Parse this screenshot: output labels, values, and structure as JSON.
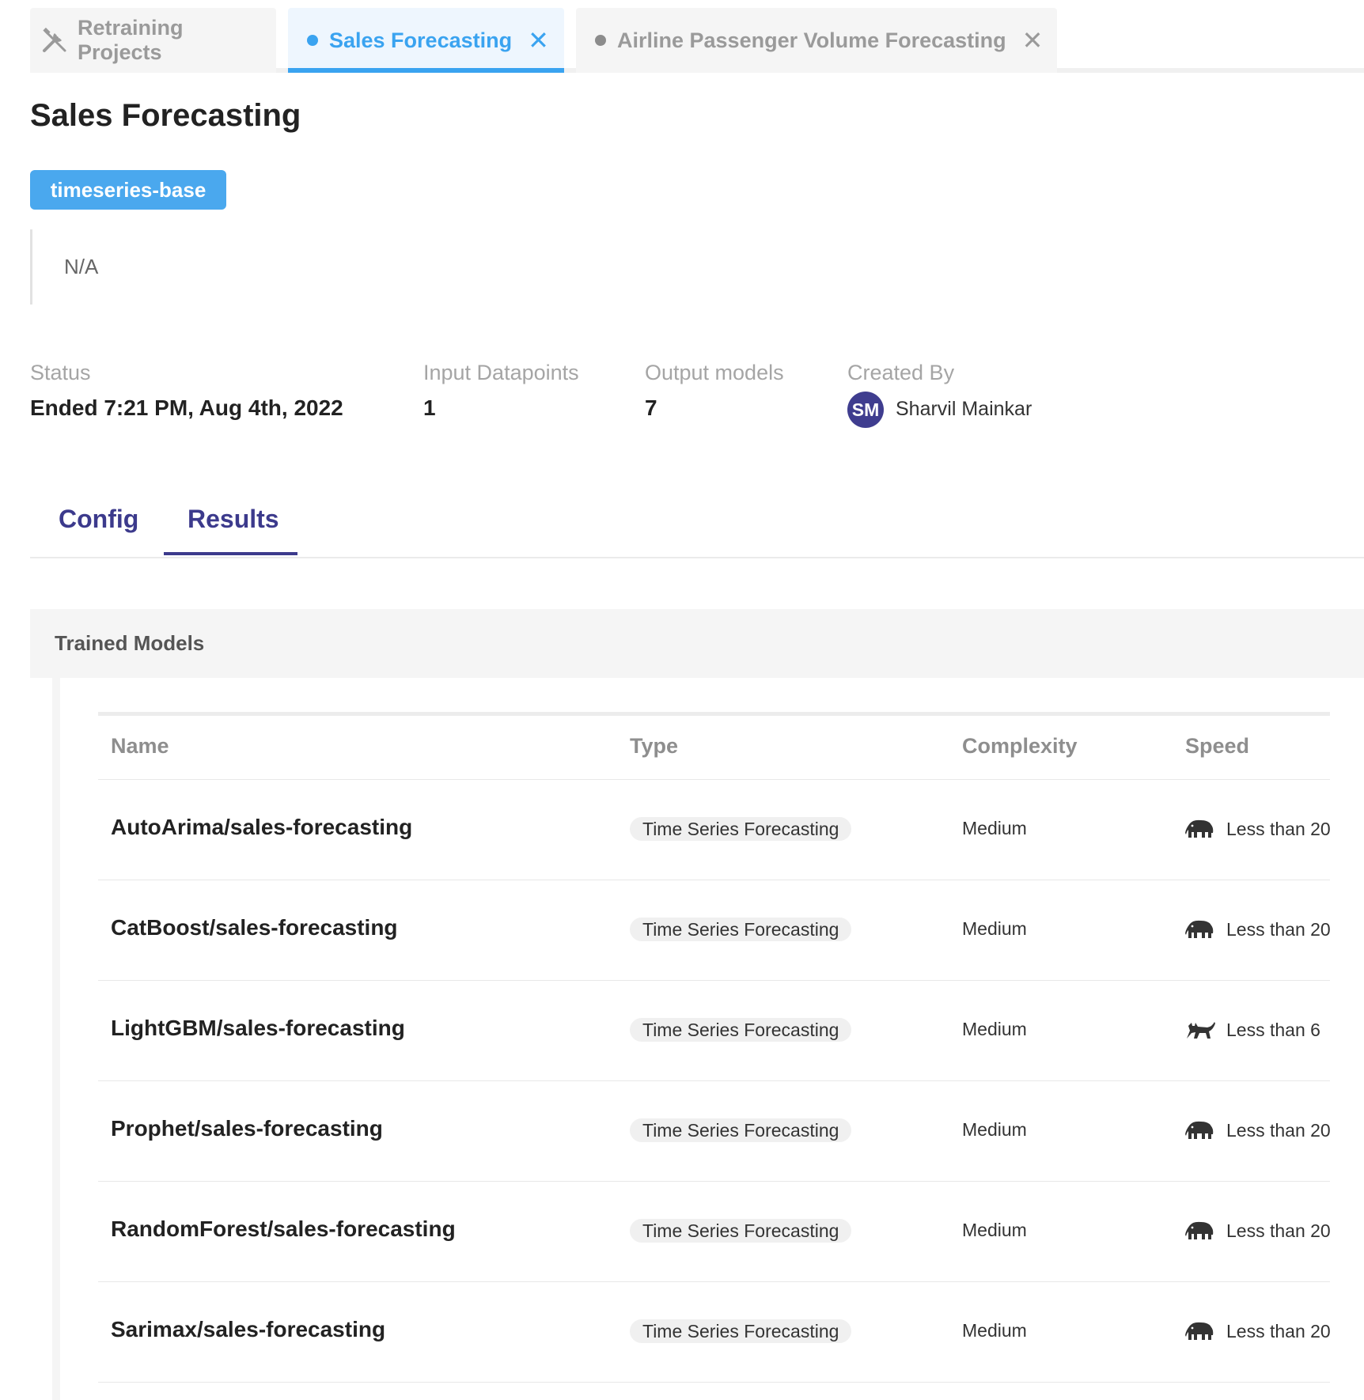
{
  "tabs": {
    "home_label": "Retraining Projects",
    "active_label": "Sales Forecasting",
    "other_label": "Airline Passenger Volume Forecasting"
  },
  "project": {
    "title": "Sales Forecasting",
    "tag": "timeseries-base",
    "description": "N/A"
  },
  "info": {
    "status_label": "Status",
    "status_value": "Ended 7:21 PM, Aug 4th, 2022",
    "input_label": "Input Datapoints",
    "input_value": "1",
    "output_label": "Output models",
    "output_value": "7",
    "created_label": "Created By",
    "avatar_initials": "SM",
    "creator_name": "Sharvil Mainkar"
  },
  "section_tabs": {
    "config": "Config",
    "results": "Results",
    "active": "Results"
  },
  "trained_models": {
    "title": "Trained Models",
    "columns": [
      "Name",
      "Type",
      "Complexity",
      "Speed"
    ],
    "rows": [
      {
        "name": "AutoArima/sales-forecasting",
        "type": "Time Series Forecasting",
        "complexity": "Medium",
        "speed_icon": "elephant-icon",
        "speed": "Less than 20"
      },
      {
        "name": "CatBoost/sales-forecasting",
        "type": "Time Series Forecasting",
        "complexity": "Medium",
        "speed_icon": "elephant-icon",
        "speed": "Less than 20"
      },
      {
        "name": "LightGBM/sales-forecasting",
        "type": "Time Series Forecasting",
        "complexity": "Medium",
        "speed_icon": "cat-icon",
        "speed": "Less than 6"
      },
      {
        "name": "Prophet/sales-forecasting",
        "type": "Time Series Forecasting",
        "complexity": "Medium",
        "speed_icon": "elephant-icon",
        "speed": "Less than 20"
      },
      {
        "name": "RandomForest/sales-forecasting",
        "type": "Time Series Forecasting",
        "complexity": "Medium",
        "speed_icon": "elephant-icon",
        "speed": "Less than 20"
      },
      {
        "name": "Sarimax/sales-forecasting",
        "type": "Time Series Forecasting",
        "complexity": "Medium",
        "speed_icon": "elephant-icon",
        "speed": "Less than 20"
      }
    ]
  },
  "colors": {
    "accent_blue": "#3aa3f0",
    "tag_blue": "#4aa8ee",
    "indigo": "#3c3a8c",
    "avatar_bg": "#3f3d8f"
  }
}
